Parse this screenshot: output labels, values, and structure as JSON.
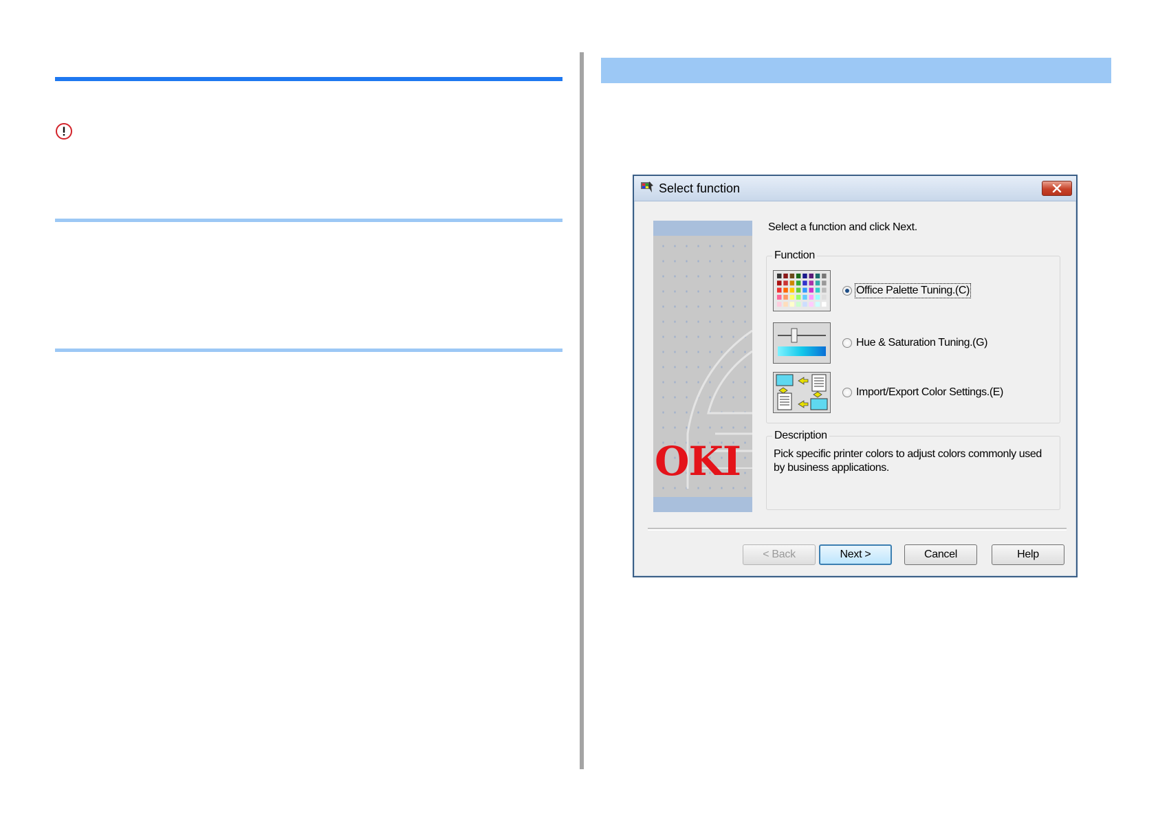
{
  "dialog": {
    "title": "Select function",
    "instruction": "Select a function and click Next.",
    "function_group_label": "Function",
    "options": [
      {
        "label": "Office Palette Tuning.(C)",
        "selected": true,
        "icon": "palette-grid-icon"
      },
      {
        "label": "Hue & Saturation Tuning.(G)",
        "selected": false,
        "icon": "slider-gradient-icon"
      },
      {
        "label": "Import/Export Color Settings.(E)",
        "selected": false,
        "icon": "import-export-icon"
      }
    ],
    "description_group_label": "Description",
    "description": "Pick specific printer colors to adjust colors commonly used by business applications.",
    "brand_logo": "OKI",
    "buttons": {
      "back": "< Back",
      "next": "Next >",
      "cancel": "Cancel",
      "help": "Help"
    }
  },
  "colors": {
    "primary_rule": "#1e78f0",
    "light_rule": "#9cc8f5",
    "brand_red": "#e4131a"
  }
}
